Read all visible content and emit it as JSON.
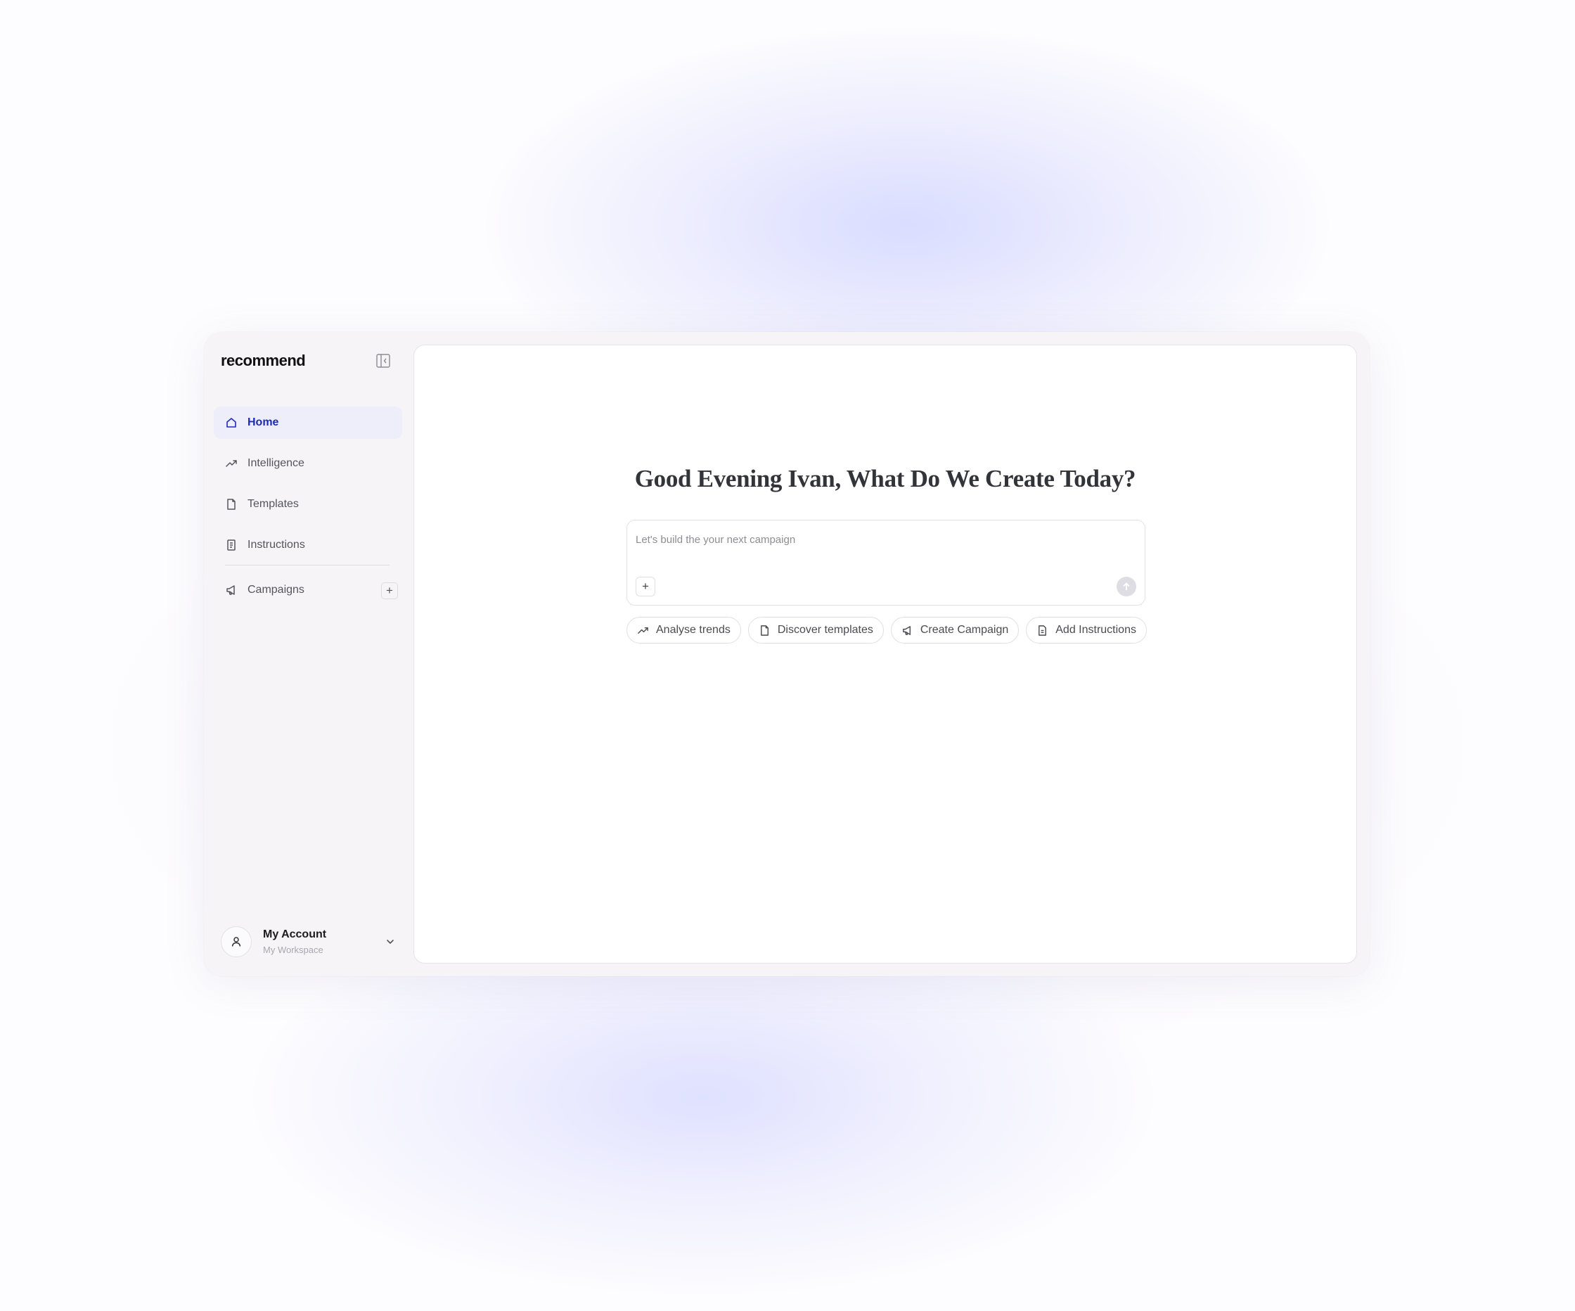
{
  "app": {
    "logo": "recommend"
  },
  "sidebar": {
    "items": [
      {
        "label": "Home",
        "icon": "home-icon",
        "active": true
      },
      {
        "label": "Intelligence",
        "icon": "trending-up-icon",
        "active": false
      },
      {
        "label": "Templates",
        "icon": "file-icon",
        "active": false
      },
      {
        "label": "Instructions",
        "icon": "notebook-icon",
        "active": false
      }
    ],
    "campaigns": {
      "label": "Campaigns",
      "icon": "megaphone-icon",
      "add_label": "+"
    },
    "collapse_icon": "sidebar-collapse-icon"
  },
  "account": {
    "name": "My Account",
    "workspace": "My Workspace",
    "icon": "user-icon"
  },
  "main": {
    "greeting": "Good Evening Ivan, What Do We Create Today?",
    "composer": {
      "placeholder": "Let's build the your next campaign",
      "attach_label": "+"
    },
    "chips": [
      {
        "label": "Analyse trends",
        "icon": "trending-up-icon"
      },
      {
        "label": "Discover templates",
        "icon": "file-icon"
      },
      {
        "label": "Create Campaign",
        "icon": "megaphone-icon"
      },
      {
        "label": "Add Instructions",
        "icon": "document-text-icon"
      }
    ]
  },
  "colors": {
    "accent": "#1d2bb8",
    "active_bg": "#eeeefb",
    "glow": "#d2d6ff"
  }
}
